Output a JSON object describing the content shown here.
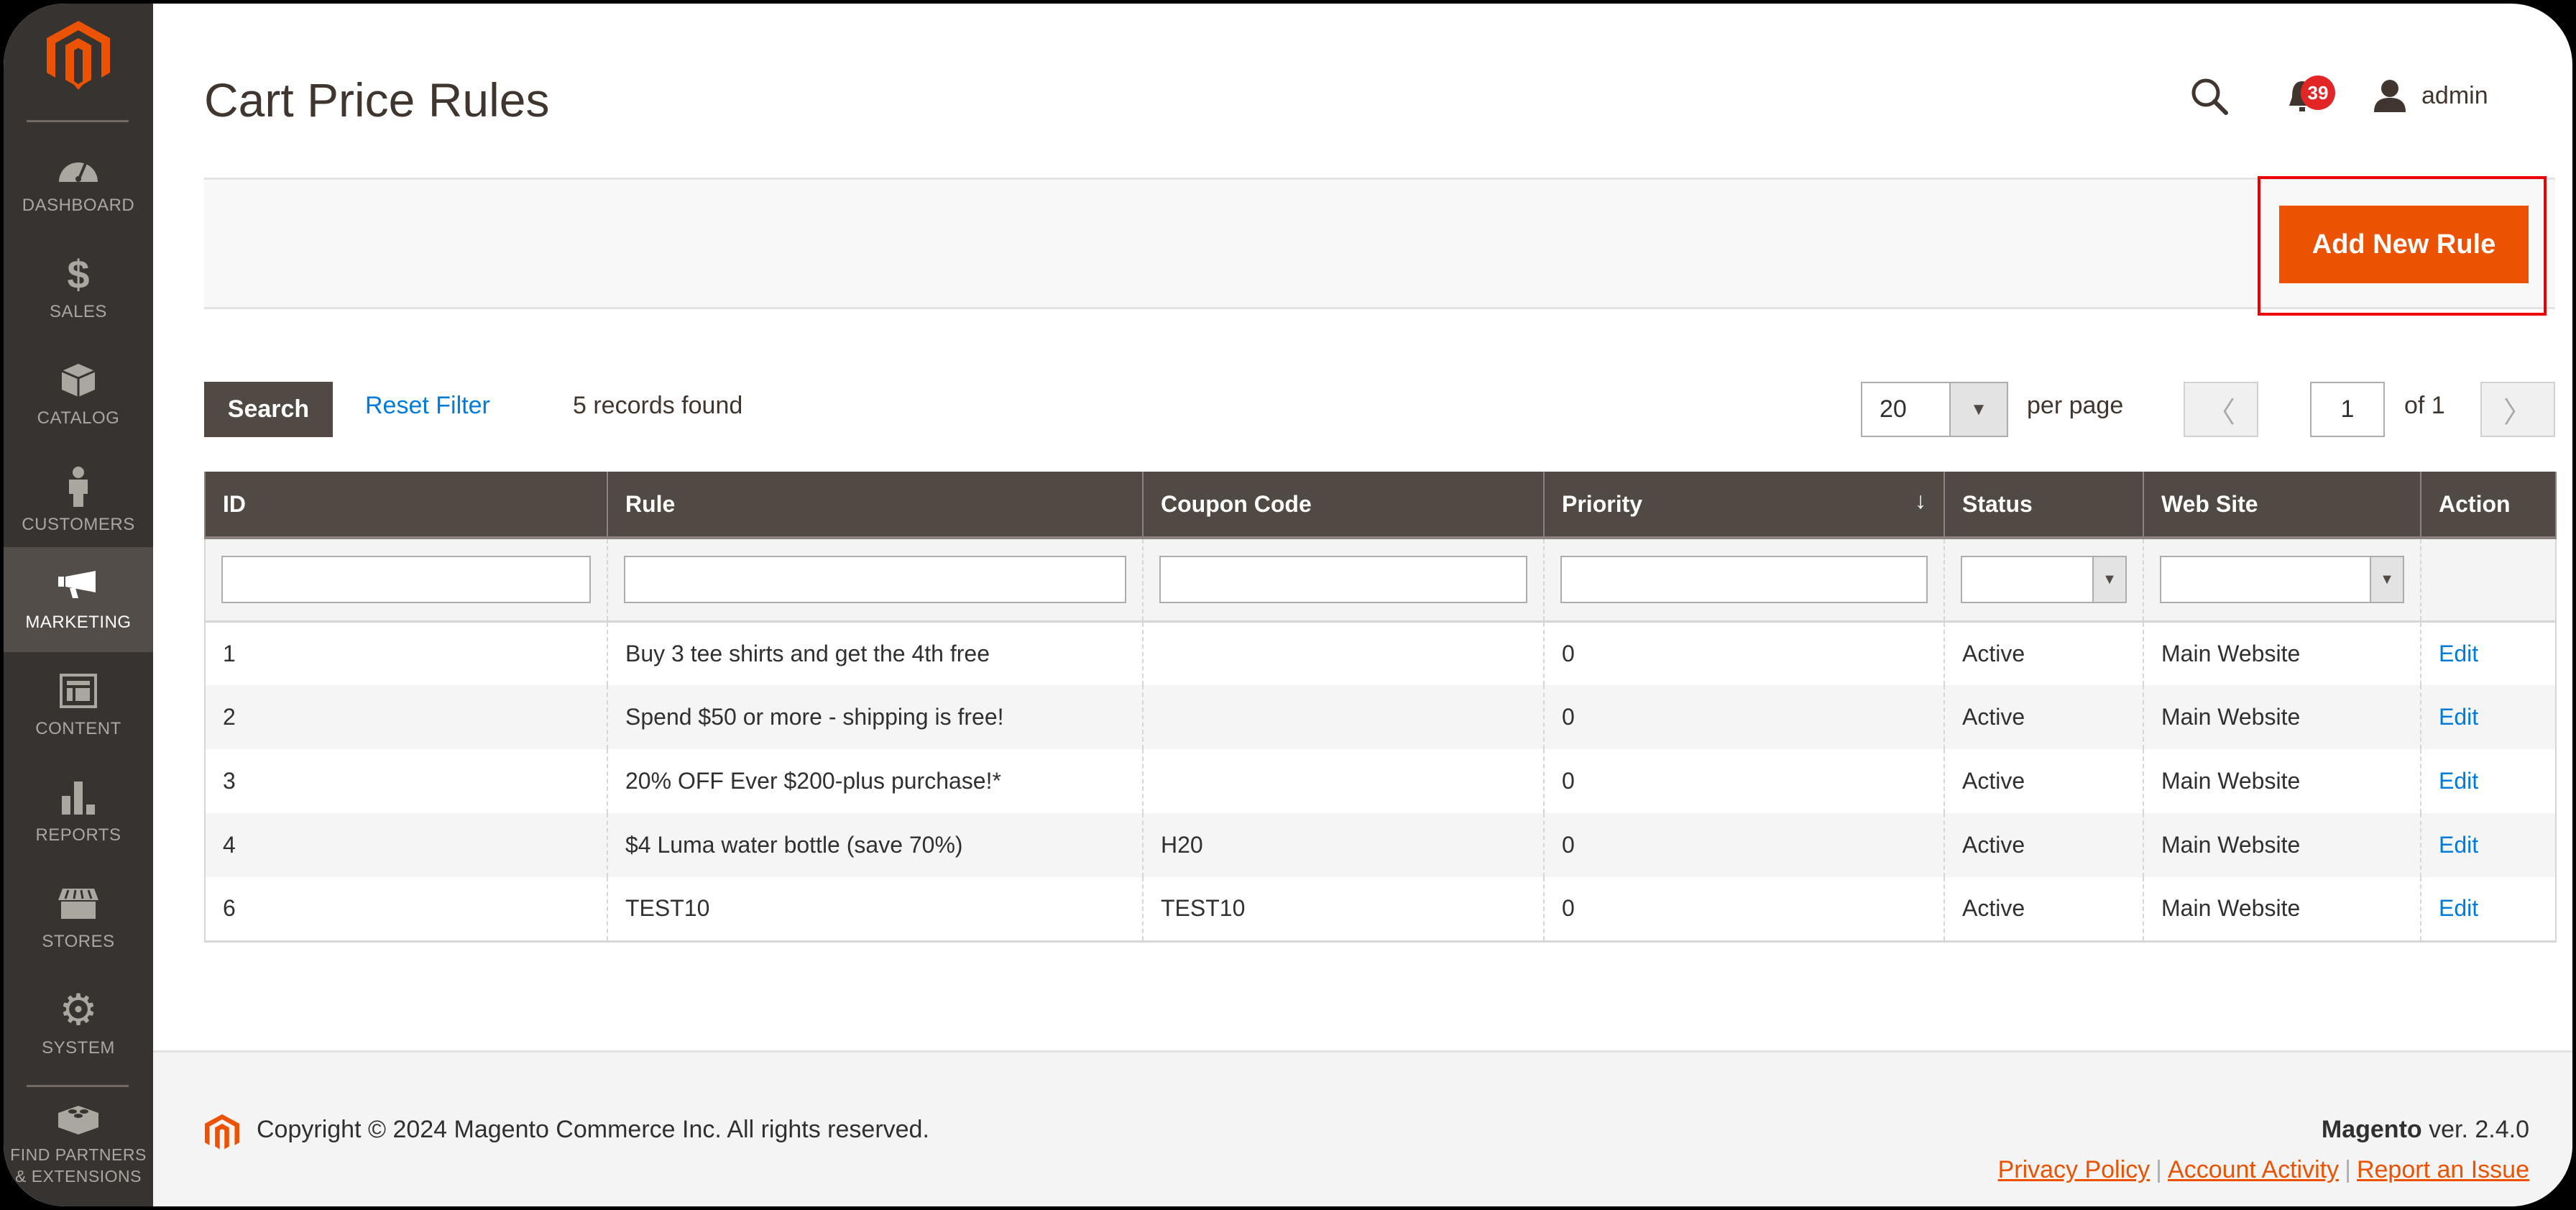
{
  "sidebar": {
    "items": [
      {
        "label": "DASHBOARD",
        "icon": "dashboard-icon"
      },
      {
        "label": "SALES",
        "icon": "dollar-icon"
      },
      {
        "label": "CATALOG",
        "icon": "box-icon"
      },
      {
        "label": "CUSTOMERS",
        "icon": "person-icon"
      },
      {
        "label": "MARKETING",
        "icon": "megaphone-icon",
        "active": true
      },
      {
        "label": "CONTENT",
        "icon": "layout-icon"
      },
      {
        "label": "REPORTS",
        "icon": "bar-chart-icon"
      },
      {
        "label": "STORES",
        "icon": "storefront-icon"
      },
      {
        "label": "SYSTEM",
        "icon": "gear-icon"
      },
      {
        "label": "FIND PARTNERS & EXTENSIONS",
        "icon": "lego-block-icon"
      }
    ]
  },
  "header": {
    "title": "Cart Price Rules",
    "notification_count": "39",
    "user_name": "admin"
  },
  "actions": {
    "add_new_rule": "Add New Rule"
  },
  "toolbar": {
    "search_label": "Search",
    "reset_filter_label": "Reset Filter",
    "records_found": "5 records found",
    "per_page_value": "20",
    "per_page_label": "per page",
    "current_page": "1",
    "page_of": "of 1"
  },
  "grid": {
    "columns": [
      "ID",
      "Rule",
      "Coupon Code",
      "Priority",
      "Status",
      "Web Site",
      "Action"
    ],
    "sort_indicator": "↓",
    "rows": [
      {
        "id": "1",
        "rule": "Buy 3 tee shirts and get the 4th free",
        "coupon": "",
        "priority": "0",
        "status": "Active",
        "website": "Main Website",
        "action": "Edit"
      },
      {
        "id": "2",
        "rule": "Spend $50 or more - shipping is free!",
        "coupon": "",
        "priority": "0",
        "status": "Active",
        "website": "Main Website",
        "action": "Edit"
      },
      {
        "id": "3",
        "rule": "20% OFF Ever $200-plus purchase!*",
        "coupon": "",
        "priority": "0",
        "status": "Active",
        "website": "Main Website",
        "action": "Edit"
      },
      {
        "id": "4",
        "rule": "$4 Luma water bottle (save 70%)",
        "coupon": "H20",
        "priority": "0",
        "status": "Active",
        "website": "Main Website",
        "action": "Edit"
      },
      {
        "id": "6",
        "rule": "TEST10",
        "coupon": "TEST10",
        "priority": "0",
        "status": "Active",
        "website": "Main Website",
        "action": "Edit"
      }
    ]
  },
  "footer": {
    "copyright": "Copyright © 2024 Magento Commerce Inc. All rights reserved.",
    "brand": "Magento",
    "version": " ver. 2.4.0",
    "links": [
      "Privacy Policy",
      "Account Activity",
      "Report an Issue"
    ]
  },
  "colors": {
    "accent": "#eb5202",
    "sidebar_bg": "#373330",
    "header_bg": "#514943",
    "link": "#007bdb",
    "badge": "#e22626",
    "highlight": "#ee0000"
  }
}
